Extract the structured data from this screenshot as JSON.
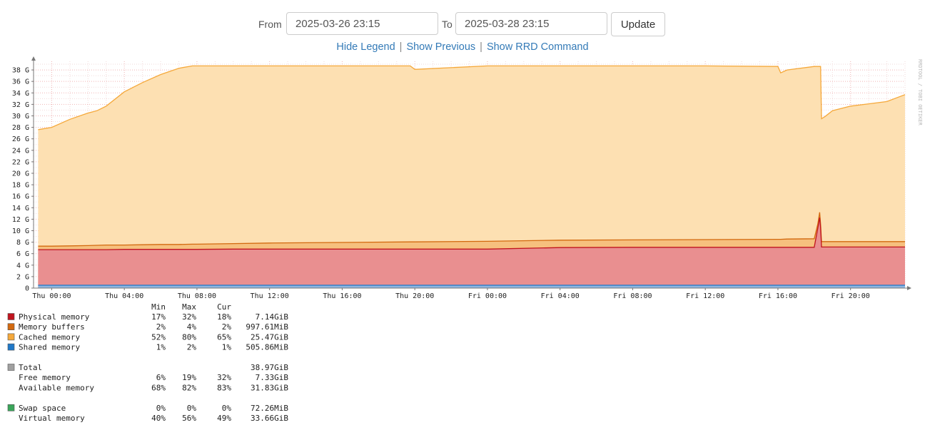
{
  "toolbar": {
    "from_label": "From",
    "from_value": "2025-03-26 23:15",
    "to_label": "To",
    "to_value": "2025-03-28 23:15",
    "update_label": "Update"
  },
  "links": {
    "hide_legend": "Hide Legend",
    "show_previous": "Show Previous",
    "show_rrd": "Show RRD Command",
    "separator": "|"
  },
  "chart_data": {
    "type": "area",
    "watermark": "RRDTOOL / TOBI OETIKER",
    "x_unit": "hours since Thu 00:00",
    "xlim": [
      -1,
      47
    ],
    "ylim": [
      0,
      39.5
    ],
    "grid": true,
    "y_ticks": [
      0,
      2,
      4,
      6,
      8,
      10,
      12,
      14,
      16,
      18,
      20,
      22,
      24,
      26,
      28,
      30,
      32,
      34,
      36,
      38
    ],
    "y_tick_labels": [
      "0",
      "2 G",
      "4 G",
      "6 G",
      "8 G",
      "10 G",
      "12 G",
      "14 G",
      "16 G",
      "18 G",
      "20 G",
      "22 G",
      "24 G",
      "26 G",
      "28 G",
      "30 G",
      "32 G",
      "34 G",
      "36 G",
      "38 G"
    ],
    "x_ticks": [
      0,
      4,
      8,
      12,
      16,
      20,
      24,
      28,
      32,
      36,
      40,
      44
    ],
    "x_tick_labels": [
      "Thu 00:00",
      "Thu 04:00",
      "Thu 08:00",
      "Thu 12:00",
      "Thu 16:00",
      "Thu 20:00",
      "Fri 00:00",
      "Fri 04:00",
      "Fri 08:00",
      "Fri 12:00",
      "Fri 16:00",
      "Fri 20:00"
    ],
    "x": [
      -0.75,
      0,
      1,
      2,
      2.5,
      3,
      4,
      5,
      6,
      7,
      7.75,
      8,
      10,
      12,
      16,
      19.75,
      20,
      24,
      28,
      32,
      36,
      40,
      40.15,
      40.5,
      42,
      42.2,
      42.3,
      42.35,
      42.4,
      42.6,
      43,
      44,
      45,
      46,
      47
    ],
    "series": [
      {
        "name": "Shared memory",
        "color": "#1f78c8",
        "values": [
          0.5,
          0.5,
          0.5,
          0.5,
          0.5,
          0.5,
          0.5,
          0.5,
          0.5,
          0.5,
          0.5,
          0.5,
          0.5,
          0.5,
          0.5,
          0.5,
          0.5,
          0.5,
          0.5,
          0.5,
          0.5,
          0.5,
          0.5,
          0.5,
          0.5,
          0.5,
          0.5,
          0.5,
          0.5,
          0.5,
          0.5,
          0.5,
          0.5,
          0.5,
          0.5
        ]
      },
      {
        "name": "Physical memory",
        "color": "#c0141e",
        "values": [
          6.7,
          6.7,
          6.7,
          6.7,
          6.7,
          6.7,
          6.75,
          6.75,
          6.75,
          6.75,
          6.75,
          6.75,
          6.8,
          6.8,
          6.8,
          6.8,
          6.8,
          6.8,
          7.05,
          7.1,
          7.1,
          7.1,
          7.1,
          7.1,
          7.1,
          10.5,
          12.3,
          10.5,
          7.15,
          7.15,
          7.15,
          7.15,
          7.15,
          7.15,
          7.15
        ]
      },
      {
        "name": "Memory buffers",
        "color": "#d2690f",
        "values": [
          7.3,
          7.3,
          7.35,
          7.4,
          7.45,
          7.5,
          7.5,
          7.55,
          7.6,
          7.6,
          7.65,
          7.65,
          7.75,
          7.85,
          7.95,
          8.05,
          8.05,
          8.15,
          8.35,
          8.4,
          8.45,
          8.5,
          8.5,
          8.55,
          8.6,
          11.2,
          13.2,
          11.2,
          8.1,
          8.1,
          8.1,
          8.1,
          8.1,
          8.1,
          8.1
        ]
      },
      {
        "name": "Cached memory",
        "color": "#f5a83a",
        "values": [
          27.6,
          28.0,
          29.4,
          30.5,
          30.9,
          31.7,
          34.2,
          35.8,
          37.2,
          38.3,
          38.7,
          38.7,
          38.7,
          38.7,
          38.7,
          38.7,
          38.1,
          38.7,
          38.7,
          38.7,
          38.7,
          38.6,
          37.5,
          38.0,
          38.6,
          38.6,
          38.6,
          38.6,
          29.5,
          29.9,
          30.9,
          31.7,
          32.1,
          32.5,
          33.7
        ]
      }
    ],
    "total_line": {
      "name": "Total",
      "value": 38.97
    }
  },
  "legend": {
    "headers": [
      "Min",
      "Max",
      "Cur"
    ],
    "rows": [
      {
        "name": "Physical memory",
        "color": "#c0141e",
        "swatch": true,
        "min": "17%",
        "max": "32%",
        "cur": "18%",
        "value": "7.14GiB"
      },
      {
        "name": "Memory buffers",
        "color": "#d2690f",
        "swatch": true,
        "min": "2%",
        "max": "4%",
        "cur": "2%",
        "value": "997.61MiB"
      },
      {
        "name": "Cached memory",
        "color": "#f5a83a",
        "swatch": true,
        "min": "52%",
        "max": "80%",
        "cur": "65%",
        "value": "25.47GiB"
      },
      {
        "name": "Shared memory",
        "color": "#1f78c8",
        "swatch": true,
        "min": "1%",
        "max": "2%",
        "cur": "1%",
        "value": "505.86MiB"
      },
      {
        "blank": true
      },
      {
        "name": "Total",
        "color": "#a0a0a0",
        "swatch": true,
        "min": "",
        "max": "",
        "cur": "",
        "value": "38.97GiB"
      },
      {
        "name": "Free memory",
        "swatch": false,
        "min": "6%",
        "max": "19%",
        "cur": "32%",
        "value": "7.33GiB"
      },
      {
        "name": "Available memory",
        "swatch": false,
        "min": "68%",
        "max": "82%",
        "cur": "83%",
        "value": "31.83GiB"
      },
      {
        "blank": true
      },
      {
        "name": "Swap space",
        "color": "#3aa65a",
        "swatch": true,
        "min": "0%",
        "max": "0%",
        "cur": "0%",
        "value": "72.26MiB"
      },
      {
        "name": "Virtual memory",
        "swatch": false,
        "min": "40%",
        "max": "56%",
        "cur": "49%",
        "value": "33.66GiB"
      }
    ]
  }
}
